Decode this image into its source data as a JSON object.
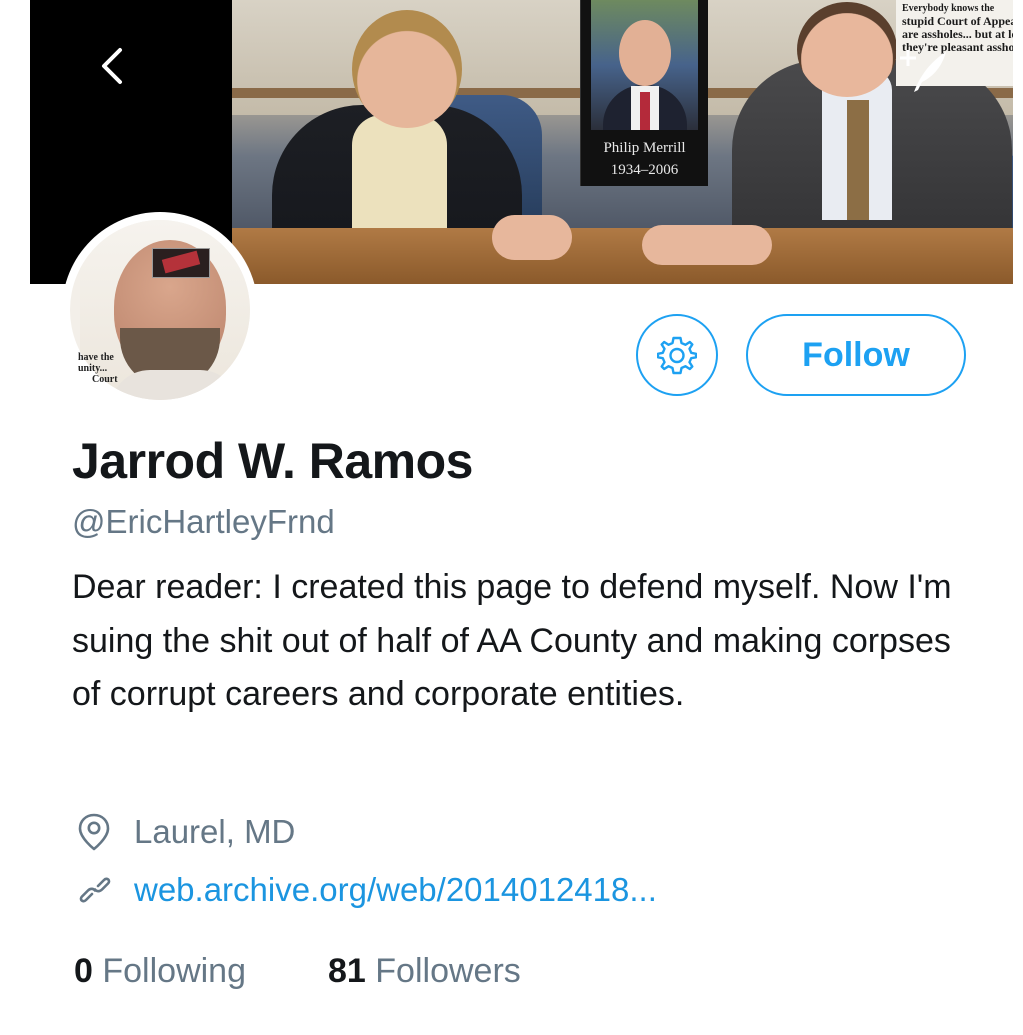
{
  "banner": {
    "portrait_caption_name": "Philip Merrill",
    "portrait_caption_years": "1934–2006",
    "quote_lines": [
      "Everybody knows the",
      "stupid Court of Appeals",
      "are assholes... but at least",
      "they're pleasant assholes"
    ]
  },
  "nav": {
    "back_icon": "chevron-left-icon",
    "compose_icon": "compose-quill-icon"
  },
  "avatar": {
    "overlay_text_lines": [
      "have the",
      "unity...",
      "Court"
    ]
  },
  "actions": {
    "settings_icon": "gear-icon",
    "follow_label": "Follow"
  },
  "profile": {
    "name": "Jarrod W. Ramos",
    "handle": "@EricHartleyFrnd",
    "bio": "Dear reader: I created this page to defend myself. Now I'm suing the shit out of half of AA County and making corpses of corrupt careers and corporate entities.",
    "location": "Laurel, MD",
    "location_icon": "location-pin-icon",
    "website": "web.archive.org/web/2014012418...",
    "website_icon": "link-icon"
  },
  "stats": {
    "following_count": "0",
    "following_label": "Following",
    "followers_count": "81",
    "followers_label": "Followers"
  },
  "colors": {
    "accent": "#1da1f2",
    "link": "#1b95e0",
    "secondary_text": "#657786",
    "primary_text": "#14171a"
  }
}
